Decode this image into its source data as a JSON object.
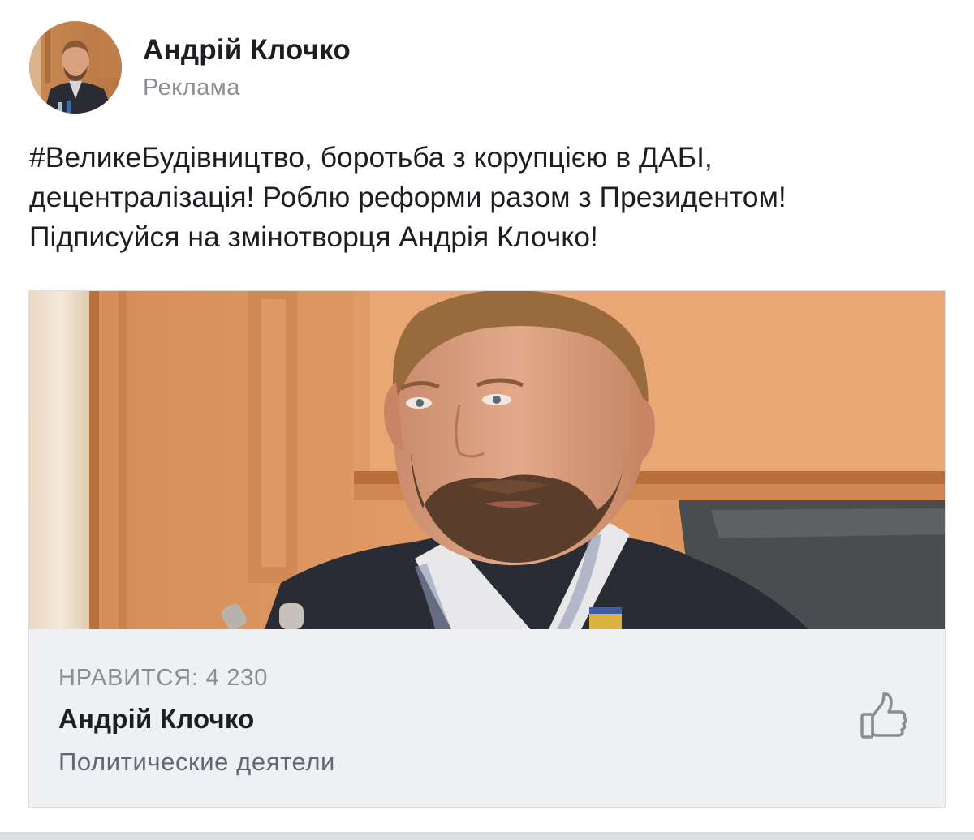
{
  "post": {
    "author_name": "Андрій Клочко",
    "sponsored_label": "Реклама",
    "text_lines": [
      "#ВеликеБудівництво, боротьба з корупцією в ДАБІ,",
      "децентралізація! Роблю реформи разом з Президентом!",
      "Підписуйся на змінотворця Андрія Клочко!"
    ]
  },
  "page_card": {
    "likes_label": "НРАВИТСЯ: 4 230",
    "page_name": "Андрій Клочко",
    "category": "Политические деятели",
    "like_icon": "thumbs-up-icon"
  },
  "colors": {
    "text_primary": "#1c1e21",
    "text_secondary": "#8a8d91",
    "card_background": "#eef0f3",
    "card_border": "#dddfe2",
    "icon_gray": "#8a8d91"
  }
}
